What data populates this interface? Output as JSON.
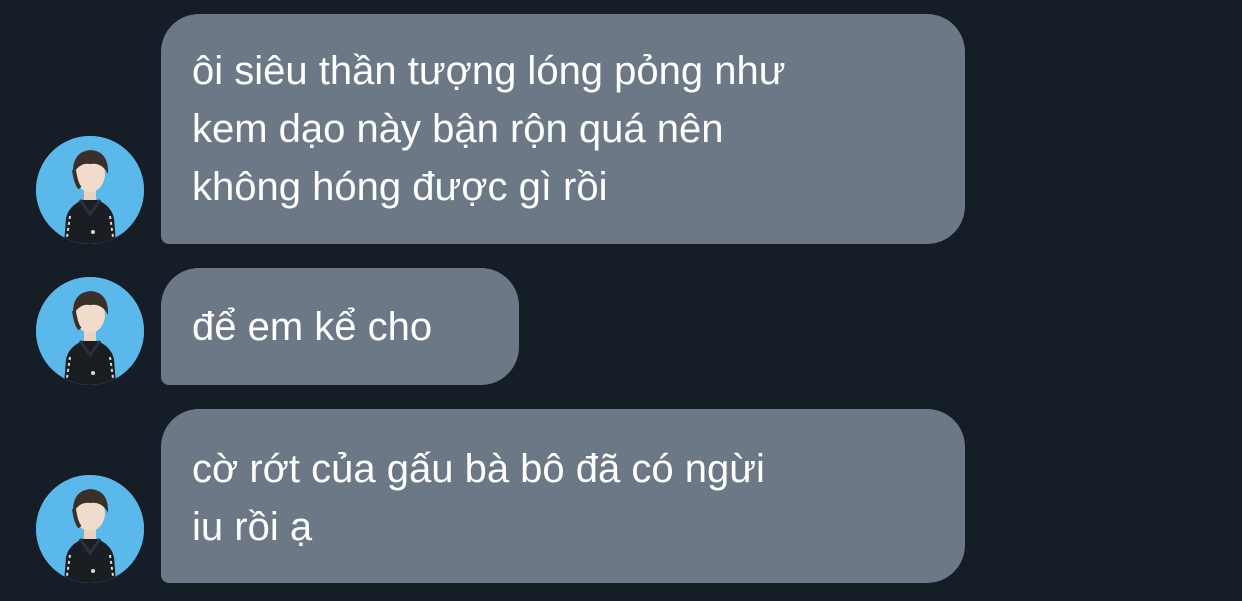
{
  "chat": {
    "messages": [
      {
        "lines": [
          "ôi siêu thần tượng lóng pỏng như",
          "kem dạo này bận rộn quá nên",
          "không hóng được gì rồi"
        ],
        "avatar_icon": "profile-photo-avatar"
      },
      {
        "lines": [
          "để em kể cho"
        ],
        "avatar_icon": "profile-photo-avatar"
      },
      {
        "lines": [
          "cờ rớt của gấu bà bô đã có ngừi",
          "iu rồi ạ"
        ],
        "avatar_icon": "profile-photo-avatar"
      }
    ]
  },
  "colors": {
    "background": "#151d27",
    "bubble": "#6c7885",
    "text": "#ffffff",
    "avatar_bg": "#5ab8ea"
  }
}
